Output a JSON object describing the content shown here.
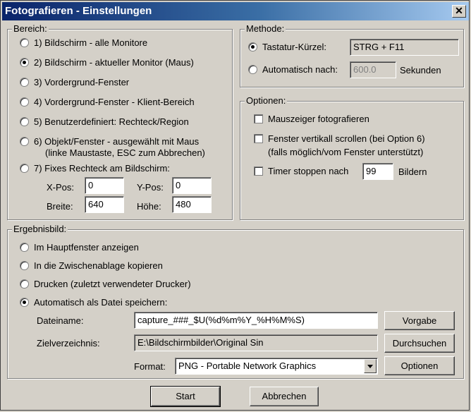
{
  "window": {
    "title": "Fotografieren - Einstellungen",
    "close_glyph": "✕"
  },
  "bereich": {
    "title": "Bereich:",
    "options": [
      "1) Bildschirm - alle Monitore",
      "2) Bildschirm - aktueller Monitor (Maus)",
      "3) Vordergrund-Fenster",
      "4) Vordergrund-Fenster - Klient-Bereich",
      "5) Benutzerdefiniert: Rechteck/Region",
      "6) Objekt/Fenster - ausgewählt mit Maus",
      "7) Fixes Rechteck am Bildschirm:"
    ],
    "option6_sub": "(linke Maustaste, ESC zum Abbrechen)",
    "selected_index": 1,
    "xpos_label": "X-Pos:",
    "xpos_value": "0",
    "ypos_label": "Y-Pos:",
    "ypos_value": "0",
    "breite_label": "Breite:",
    "breite_value": "640",
    "hoehe_label": "Höhe:",
    "hoehe_value": "480"
  },
  "methode": {
    "title": "Methode:",
    "shortcut_label": "Tastatur-Kürzel:",
    "shortcut_value": "STRG + F11",
    "auto_label": "Automatisch nach:",
    "auto_value": "600.0",
    "auto_unit": "Sekunden",
    "selected": "shortcut"
  },
  "optionen": {
    "title": "Optionen:",
    "mouse_label": "Mauszeiger fotografieren",
    "scroll_label": "Fenster vertikall scrollen (bei Option 6)",
    "scroll_sub": "(falls möglich/vom Fenster unterstützt)",
    "timer_label": "Timer stoppen nach",
    "timer_value": "99",
    "timer_unit": "Bildern"
  },
  "ergebnis": {
    "title": "Ergebnisbild:",
    "options": [
      "Im Hauptfenster anzeigen",
      "In die Zwischenablage kopieren",
      "Drucken (zuletzt verwendeter Drucker)",
      "Automatisch als Datei speichern:"
    ],
    "selected_index": 3,
    "filename_label": "Dateiname:",
    "filename_value": "capture_###_$U(%d%m%Y_%H%M%S)",
    "dir_label": "Zielverzeichnis:",
    "dir_value": "E:\\Bildschirmbilder\\Original Sin",
    "format_label": "Format:",
    "format_value": "PNG - Portable Network Graphics",
    "vorgabe_button": "Vorgabe",
    "durchsuchen_button": "Durchsuchen",
    "optionen_button": "Optionen"
  },
  "footer": {
    "start_button": "Start",
    "cancel_button": "Abbrechen"
  }
}
